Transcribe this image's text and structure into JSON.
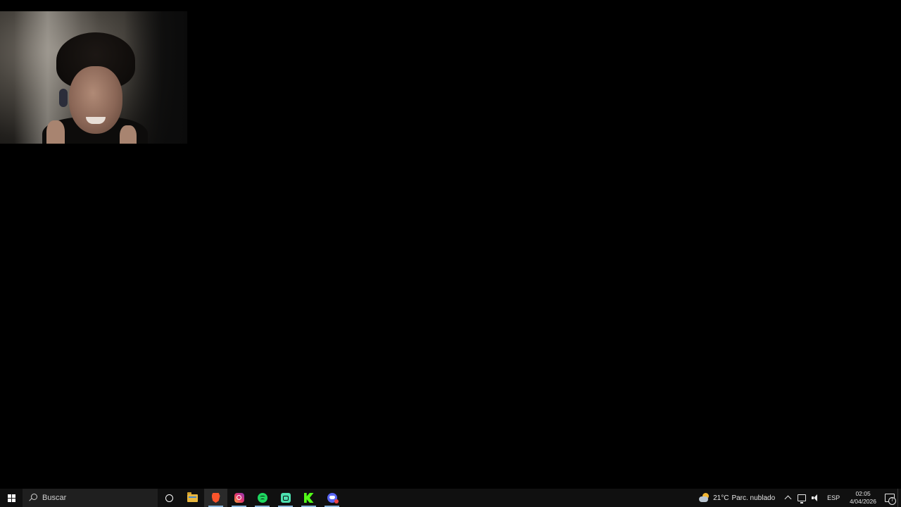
{
  "taskbar": {
    "search": {
      "placeholder": "Buscar"
    },
    "pinned_apps": [
      {
        "name": "cortana"
      },
      {
        "name": "file-explorer"
      },
      {
        "name": "brave"
      },
      {
        "name": "instagram"
      },
      {
        "name": "spotify"
      },
      {
        "name": "streamlabs"
      },
      {
        "name": "kick"
      },
      {
        "name": "discord"
      }
    ],
    "weather": {
      "temp": "21°C",
      "condition": "Parc. nublado"
    },
    "tray": {
      "language": "ESP",
      "time": "02:05",
      "date": "4/04/2026",
      "notification_count": "7"
    }
  },
  "colors": {
    "taskbar_bg": "#101010",
    "desktop_bg": "#000000",
    "running_indicator": "#8ab4d8"
  }
}
